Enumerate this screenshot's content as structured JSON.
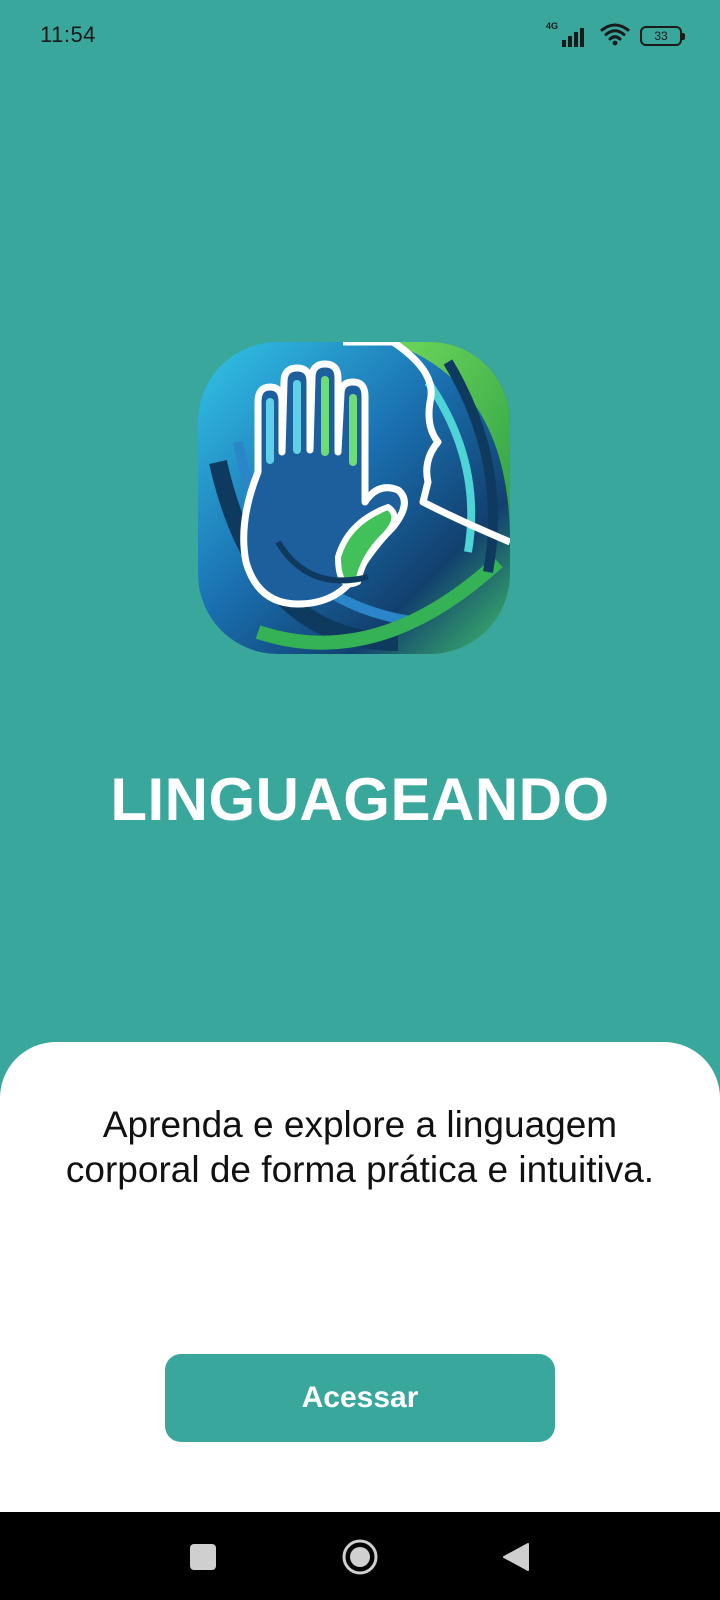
{
  "status_bar": {
    "time": "11:54",
    "network": "4G",
    "battery": "33",
    "icons": [
      "signal-icon",
      "wifi-icon",
      "battery-icon"
    ]
  },
  "app": {
    "name": "LINGUAGEANDO",
    "logo_icon": "hand-fingerprint-logo",
    "tagline": "Aprenda e explore a linguagem corporal de forma prática e intuitiva.",
    "access_label": "Acessar"
  },
  "nav_bar": {
    "buttons": [
      "recents-button",
      "home-button",
      "back-button"
    ]
  },
  "colors": {
    "background": "#3aa79d",
    "sheet": "#ffffff",
    "button": "#3aa79d",
    "nav": "#000000"
  }
}
